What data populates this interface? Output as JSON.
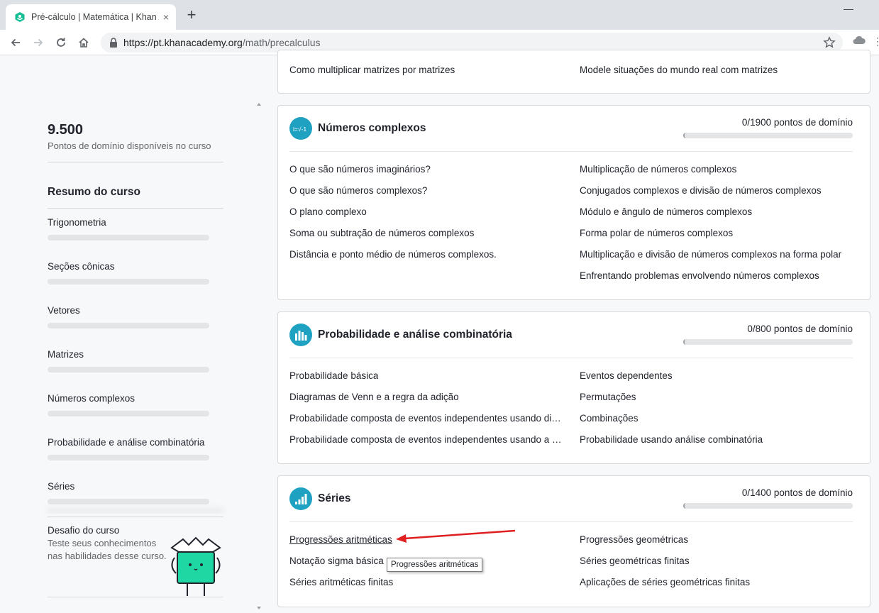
{
  "browser": {
    "tab_title": "Pré-cálculo | Matemática | Khan Academy",
    "tab_close": "×",
    "new_tab": "+",
    "url_host": "https://pt.khanacademy.org",
    "url_path": "/math/precalculus",
    "minimize": "—"
  },
  "sidebar": {
    "points": "9.500",
    "points_caption": "Pontos de domínio disponíveis no curso",
    "summary_title": "Resumo do curso",
    "items": [
      {
        "label": "Trigonometria",
        "progress": 0
      },
      {
        "label": "Seções cônicas",
        "progress": 0
      },
      {
        "label": "Vetores",
        "progress": 0
      },
      {
        "label": "Matrizes",
        "progress": 0
      },
      {
        "label": "Números complexos",
        "progress": 0
      },
      {
        "label": "Probabilidade e análise combinatória",
        "progress": 0
      },
      {
        "label": "Séries",
        "progress": 0
      }
    ],
    "challenge_title": "Desafio do curso",
    "challenge_desc": "Teste seus conhecimentos nas habilidades desse curso."
  },
  "cards": {
    "matrices_tail": {
      "left": "Como multiplicar matrizes por matrizes",
      "right": "Modele situações do mundo real com matrizes"
    },
    "complex": {
      "title": "Números complexos",
      "points": "0/1900 pontos de domínio",
      "progress": 0,
      "left": [
        "O que são números imaginários?",
        "O que são números complexos?",
        "O plano complexo",
        "Soma ou subtração de números complexos",
        "Distância e ponto médio de números complexos."
      ],
      "right": [
        "Multiplicação de números complexos",
        "Conjugados complexos e divisão de números complexos",
        "Módulo e ângulo de números complexos",
        "Forma polar de números complexos",
        "Multiplicação e divisão de números complexos na forma polar",
        "Enfrentando problemas envolvendo números complexos"
      ]
    },
    "probability": {
      "title": "Probabilidade e análise combinatória",
      "points": "0/800 pontos de domínio",
      "progress": 0,
      "left": [
        "Probabilidade básica",
        "Diagramas de Venn e a regra da adição",
        "Probabilidade composta de eventos independentes usando diagramas",
        "Probabilidade composta de eventos independentes usando a regra"
      ],
      "right": [
        "Eventos dependentes",
        "Permutações",
        "Combinações",
        "Probabilidade usando análise combinatória"
      ]
    },
    "series": {
      "title": "Séries",
      "points": "0/1400 pontos de domínio",
      "progress": 0,
      "left": [
        "Progressões aritméticas",
        "Notação sigma básica",
        "Séries aritméticas finitas"
      ],
      "right": [
        "Progressões geométricas",
        "Séries geométricas finitas",
        "Aplicações de séries geométricas finitas"
      ]
    }
  },
  "tooltip": "Progressões aritméticas",
  "colors": {
    "accent": "#1fa2c1",
    "arrow": "#e02020",
    "favicon": "#14bf96"
  }
}
